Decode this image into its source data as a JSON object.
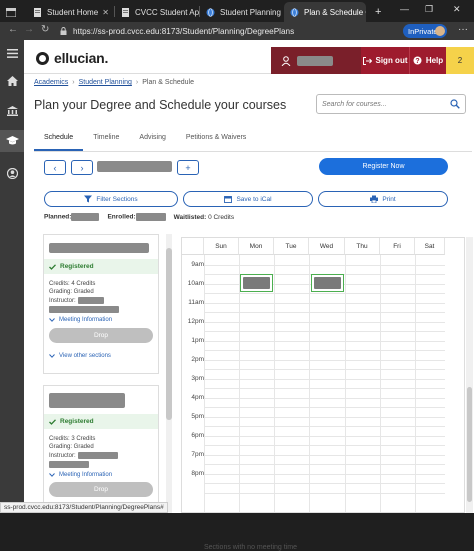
{
  "browser": {
    "tabs": [
      {
        "label": "Student Home",
        "active": false
      },
      {
        "label": "CVCC Student Appli",
        "active": false
      },
      {
        "label": "Student Planning - C",
        "active": false
      },
      {
        "label": "Plan & Schedule Co",
        "active": true
      }
    ],
    "new_tab": "+",
    "window_controls": {
      "minimize": "—",
      "maximize": "❐",
      "close": "✕"
    },
    "url": "https://ss-prod.cvcc.edu:8173/Student/Planning/DegreePlans",
    "inprivate_label": "InPrivate",
    "menu": "···",
    "status_url": "ss-prod.cvcc.edu:8173/Student/Planning/DegreePlans#"
  },
  "header": {
    "logo_text": "ellucian.",
    "sign_out": "Sign out",
    "help": "Help",
    "notifications": "2"
  },
  "breadcrumb": {
    "items": [
      "Academics",
      "Student Planning",
      "Plan & Schedule"
    ],
    "separator": "›"
  },
  "page": {
    "title": "Plan your Degree and Schedule your courses",
    "search_placeholder": "Search for courses..."
  },
  "tabs": [
    "Schedule",
    "Timeline",
    "Advising",
    "Petitions & Waivers"
  ],
  "toolbar": {
    "prev": "‹",
    "next": "›",
    "add": "+",
    "register_now": "Register Now",
    "filter_sections": "Filter Sections",
    "save_to_ical": "Save to iCal",
    "print": "Print"
  },
  "summary": {
    "planned_label": "Planned:",
    "enrolled_label": "Enrolled:",
    "waitlisted_label": "Waitlisted:",
    "waitlisted_value": "0 Credits"
  },
  "courses": [
    {
      "status": "Registered",
      "credits": "Credits: 4 Credits",
      "grading": "Grading: Graded",
      "instructor_label": "Instructor:",
      "meeting_info": "Meeting Information",
      "drop": "Drop",
      "view_other": "View other sections"
    },
    {
      "status": "Registered",
      "credits": "Credits: 3 Credits",
      "grading": "Grading: Graded",
      "instructor_label": "Instructor:",
      "meeting_info": "Meeting Information",
      "drop": "Drop"
    }
  ],
  "calendar": {
    "days": [
      "Sun",
      "Mon",
      "Tue",
      "Wed",
      "Thu",
      "Fri",
      "Sat"
    ],
    "times": [
      "9am",
      "10am",
      "11am",
      "12pm",
      "1pm",
      "2pm",
      "3pm",
      "4pm",
      "5pm",
      "6pm",
      "7pm",
      "8pm"
    ]
  },
  "footer": {
    "no_meeting_text": "Sections with no meeting time"
  }
}
